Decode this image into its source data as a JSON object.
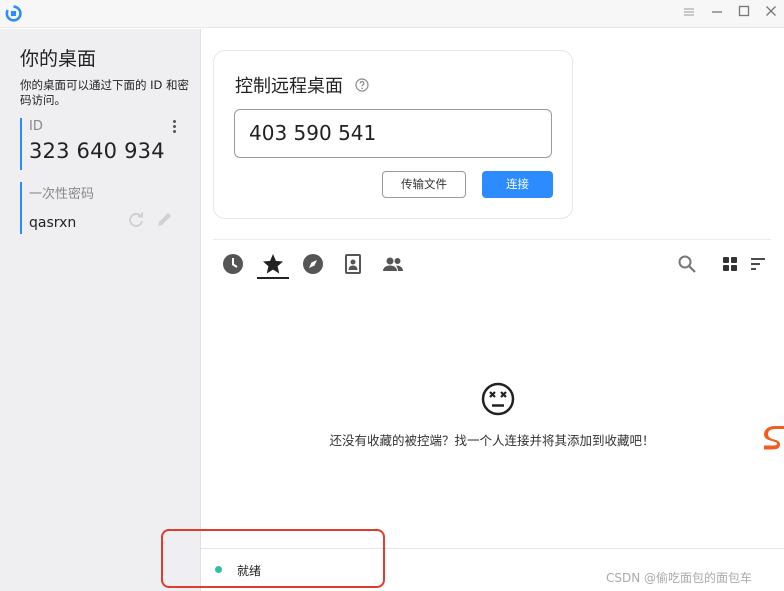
{
  "titlebar": {
    "logo_icon": "rustdesk-logo-icon",
    "buttons": [
      "menu-icon",
      "minimize-icon",
      "maximize-icon",
      "close-icon"
    ]
  },
  "left": {
    "title": "你的桌面",
    "description": "你的桌面可以通过下面的 ID 和密码访问。",
    "id_label": "ID",
    "id_value": "323 640 934",
    "password_label": "一次性密码",
    "password_value": "qasrxn"
  },
  "control": {
    "title": "控制远程桌面",
    "remote_id_value": "403 590 541",
    "transfer_label": "传输文件",
    "connect_label": "连接"
  },
  "tabs": [
    {
      "icon": "clock-icon",
      "active": false
    },
    {
      "icon": "star-icon",
      "active": true
    },
    {
      "icon": "compass-icon",
      "active": false
    },
    {
      "icon": "address-book-icon",
      "active": false
    },
    {
      "icon": "group-icon",
      "active": false
    }
  ],
  "tools": [
    "search-icon",
    "grid-view-icon",
    "sort-icon"
  ],
  "empty_state": {
    "icon": "dizzy-face-icon",
    "message": "还没有收藏的被控端？找一个人连接并将其添加到收藏吧！"
  },
  "status": {
    "text": "就绪",
    "color": "#32bea6"
  },
  "watermark": "CSDN @偷吃面包的面包车",
  "colors": {
    "accent": "#2c8cff",
    "highlight": "#e03b2e"
  }
}
